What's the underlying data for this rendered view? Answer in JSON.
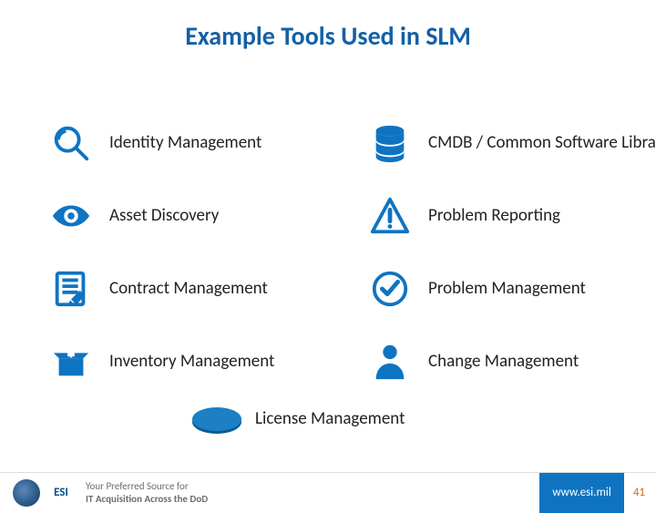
{
  "title": "Example Tools Used in SLM",
  "left": [
    {
      "label": "Identity Management"
    },
    {
      "label": "Asset Discovery"
    },
    {
      "label": "Contract Management"
    },
    {
      "label": "Inventory Management"
    }
  ],
  "right": [
    {
      "label": "CMDB /  Common Software Library"
    },
    {
      "label": "Problem Reporting"
    },
    {
      "label": "Problem Management"
    },
    {
      "label": "Change Management"
    }
  ],
  "bottom": {
    "label": "License Management"
  },
  "footer": {
    "logo2": "ESI",
    "tagline_line1": "Your Preferred Source for",
    "tagline_line2": "IT Acquisition Across the DoD",
    "url": "www.esi.mil",
    "page": "41"
  }
}
